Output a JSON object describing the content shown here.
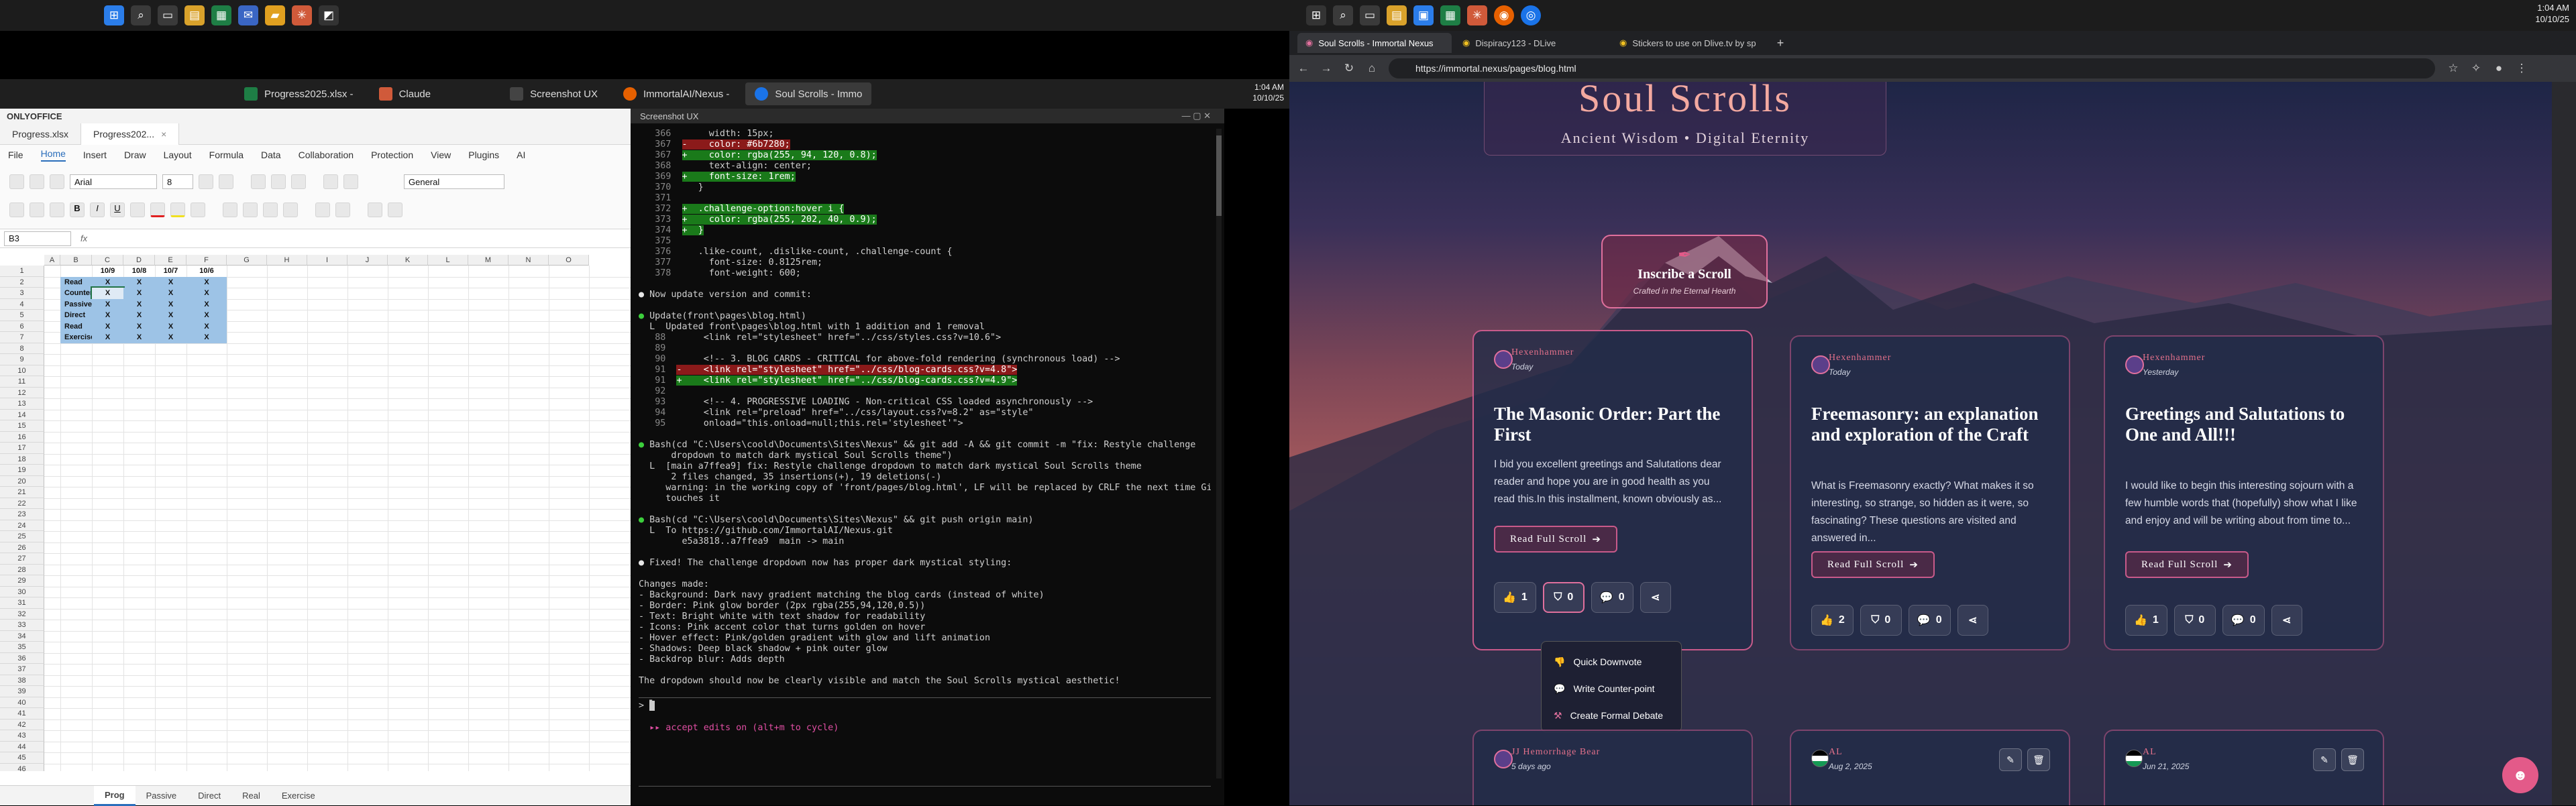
{
  "left_taskbar": {
    "icons": [
      "start-icon",
      "search-icon",
      "taskview-icon",
      "explorer-icon",
      "store-icon",
      "mail-icon",
      "folder-icon",
      "claude-icon",
      "screenshot-icon"
    ],
    "time": "1:04 AM",
    "date": "10/10/25"
  },
  "apps_bar": {
    "items": [
      {
        "label": "Progress2025.xlsx -",
        "color": "#1e7e45"
      },
      {
        "label": "Claude",
        "color": "#d05a3a"
      },
      {
        "label": "Screenshot UX",
        "color": "#444"
      },
      {
        "label": "ImmortalAI/Nexus -",
        "color": "#e66000"
      },
      {
        "label": "Soul Scrolls - Immo",
        "color": "#1a73e8"
      }
    ]
  },
  "sheet": {
    "app_name": "ONLYOFFICE",
    "doc_tabs": [
      "Progress.xlsx",
      "Progress202..."
    ],
    "menu": [
      "File",
      "Home",
      "Insert",
      "Draw",
      "Layout",
      "Formula",
      "Data",
      "Collaboration",
      "Protection",
      "View",
      "Plugins",
      "AI"
    ],
    "font": "Arial",
    "font_size": "8",
    "number_format": "General",
    "cell_ref": "B3",
    "fx": "fx",
    "columns": [
      "A",
      "B",
      "C",
      "D",
      "E",
      "F",
      "G",
      "H",
      "I",
      "J",
      "K",
      "L",
      "M",
      "N",
      "O"
    ],
    "rows": [
      "1",
      "2",
      "3",
      "4",
      "5",
      "6",
      "7",
      "8",
      "9",
      "10",
      "11",
      "12",
      "13",
      "14",
      "15",
      "16",
      "17",
      "18",
      "19",
      "20",
      "21",
      "22",
      "23",
      "24",
      "25",
      "26",
      "27",
      "28",
      "29",
      "30",
      "31",
      "32",
      "33",
      "34",
      "35",
      "36",
      "37",
      "38",
      "39",
      "40",
      "41",
      "42",
      "43",
      "44",
      "45",
      "46"
    ],
    "header_dates": [
      "10/9",
      "10/8",
      "10/7",
      "10/6"
    ],
    "row_labels": [
      "Read",
      "Counter",
      "Passive",
      "Direct",
      "Read",
      "Exercise"
    ],
    "x_mark": "X",
    "sheet_tabs": [
      "Prog",
      "Passive",
      "Direct",
      "Real",
      "Exercise"
    ]
  },
  "terminal": {
    "title": "Screenshot UX",
    "lines": [
      {
        "n": "366",
        "t": "     width: 15px;",
        "k": ""
      },
      {
        "n": "367",
        "t": "-    color: #6b7280;",
        "k": "del"
      },
      {
        "n": "367",
        "t": "+    color: rgba(255, 94, 120, 0.8);",
        "k": "add"
      },
      {
        "n": "368",
        "t": "     text-align: center;",
        "k": ""
      },
      {
        "n": "369",
        "t": "+    font-size: 1rem;",
        "k": "add"
      },
      {
        "n": "370",
        "t": "   }",
        "k": ""
      },
      {
        "n": "371",
        "t": "",
        "k": ""
      },
      {
        "n": "372",
        "t": "+  .challenge-option:hover i {",
        "k": "add"
      },
      {
        "n": "373",
        "t": "+    color: rgba(255, 202, 40, 0.9);",
        "k": "add"
      },
      {
        "n": "374",
        "t": "+  }",
        "k": "add"
      },
      {
        "n": "375",
        "t": "",
        "k": ""
      },
      {
        "n": "376",
        "t": "   .like-count, .dislike-count, .challenge-count {",
        "k": ""
      },
      {
        "n": "377",
        "t": "     font-size: 0.8125rem;",
        "k": ""
      },
      {
        "n": "378",
        "t": "     font-weight: 600;",
        "k": ""
      }
    ],
    "msg1": "Now update version and commit:",
    "update_head": "Update(front\\pages\\blog.html)",
    "update_sum": "  L  Updated front\\pages\\blog.html with 1 addition and 1 removal",
    "diff2": [
      {
        "n": "88",
        "t": "     <link rel=\"stylesheet\" href=\"../css/styles.css?v=10.6\">",
        "k": ""
      },
      {
        "n": "89",
        "t": "",
        "k": ""
      },
      {
        "n": "90",
        "t": "     <!-- 3. BLOG CARDS - CRITICAL for above-fold rendering (synchronous load) -->",
        "k": ""
      },
      {
        "n": "91",
        "t": "-    <link rel=\"stylesheet\" href=\"../css/blog-cards.css?v=4.8\">",
        "k": "del"
      },
      {
        "n": "91",
        "t": "+    <link rel=\"stylesheet\" href=\"../css/blog-cards.css?v=4.9\">",
        "k": "add"
      },
      {
        "n": "92",
        "t": "",
        "k": ""
      },
      {
        "n": "93",
        "t": "     <!-- 4. PROGRESSIVE LOADING - Non-critical CSS loaded asynchronously -->",
        "k": ""
      },
      {
        "n": "94",
        "t": "     <link rel=\"preload\" href=\"../css/layout.css?v=8.2\" as=\"style\"",
        "k": ""
      },
      {
        "n": "95",
        "t": "     onload=\"this.onload=null;this.rel='stylesheet'\">",
        "k": ""
      }
    ],
    "bash1": "Bash(cd \"C:\\Users\\coold\\Documents\\Sites\\Nexus\" && git add -A && git commit -m \"fix: Restyle challenge",
    "bash1b": "      dropdown to match dark mystical Soul Scrolls theme\")",
    "bash1_out": [
      "  L  [main a7ffea9] fix: Restyle challenge dropdown to match dark mystical Soul Scrolls theme",
      "      2 files changed, 35 insertions(+), 19 deletions(-)",
      "     warning: in the working copy of 'front/pages/blog.html', LF will be replaced by CRLF the next time Git",
      "     touches it"
    ],
    "bash2": "Bash(cd \"C:\\Users\\coold\\Documents\\Sites\\Nexus\" && git push origin main)",
    "bash2_out": [
      "  L  To https://github.com/ImmortalAI/Nexus.git",
      "        e5a3818..a7ffea9  main -> main"
    ],
    "fixed": "Fixed! The challenge dropdown now has proper dark mystical styling:",
    "changes_head": "Changes made:",
    "changes": [
      "- Background: Dark navy gradient matching the blog cards (instead of white)",
      "- Border: Pink glow border (2px rgba(255,94,120,0.5))",
      "- Text: Bright white with text shadow for readability",
      "- Icons: Pink accent color that turns golden on hover",
      "- Hover effect: Pink/golden gradient with glow and lift animation",
      "- Shadows: Deep black shadow + pink outer glow",
      "- Backdrop blur: Adds depth"
    ],
    "closing": "The dropdown should now be clearly visible and match the Soul Scrolls mystical aesthetic!",
    "prompt": ">",
    "mode": "  ▸▸ accept edits on (alt+m to cycle)"
  },
  "browser": {
    "tabs": [
      "Soul Scrolls - Immortal Nexus",
      "Dispiracy123 - DLive",
      "Stickers to use on Dlive.tv by sp"
    ],
    "url": "https://immortal.nexus/pages/blog.html",
    "time": "1:04 AM",
    "date": "10/10/25"
  },
  "site": {
    "title": "Soul Scrolls",
    "subtitle": "Ancient Wisdom • Digital Eternity",
    "inscribe_title": "Inscribe a Scroll",
    "inscribe_sub": "Crafted in the Eternal Hearth",
    "cards": [
      {
        "author": "Hexenhammer",
        "date": "Today",
        "title": "The Masonic Order: Part the First",
        "excerpt": "I bid you excellent greetings and Salutations dear reader and hope you are in good health as you read this.In this installment, known obviously as...",
        "read": "Read Full Scroll",
        "likes": "1",
        "dislikes": "0",
        "challenges": "0"
      },
      {
        "author": "Hexenhammer",
        "date": "Today",
        "title": "Freemasonry: an explanation and exploration of the Craft",
        "excerpt": "What is Freemasonry exactly? What makes it so interesting, so strange, so hidden as it were, so fascinating? These questions are visited and answered in...",
        "read": "Read Full Scroll",
        "likes": "2",
        "dislikes": "0",
        "challenges": "0"
      },
      {
        "author": "Hexenhammer",
        "date": "Yesterday",
        "title": "Greetings and Salutations to One and All!!!",
        "excerpt": "I would like to begin this interesting sojourn with a few humble words that (hopefully) show what I like and enjoy and will be writing about from time to...",
        "read": "Read Full Scroll",
        "likes": "1",
        "dislikes": "0",
        "challenges": "0"
      }
    ],
    "dropdown": [
      "Quick Downvote",
      "Write Counter-point",
      "Create Formal Debate"
    ],
    "bottom_cards": [
      {
        "author": "JJ Hemorrhage Bear",
        "date": "5 days ago"
      },
      {
        "author": "AL",
        "date": "Aug 2, 2025"
      },
      {
        "author": "AL",
        "date": "Jun 21, 2025"
      }
    ]
  }
}
